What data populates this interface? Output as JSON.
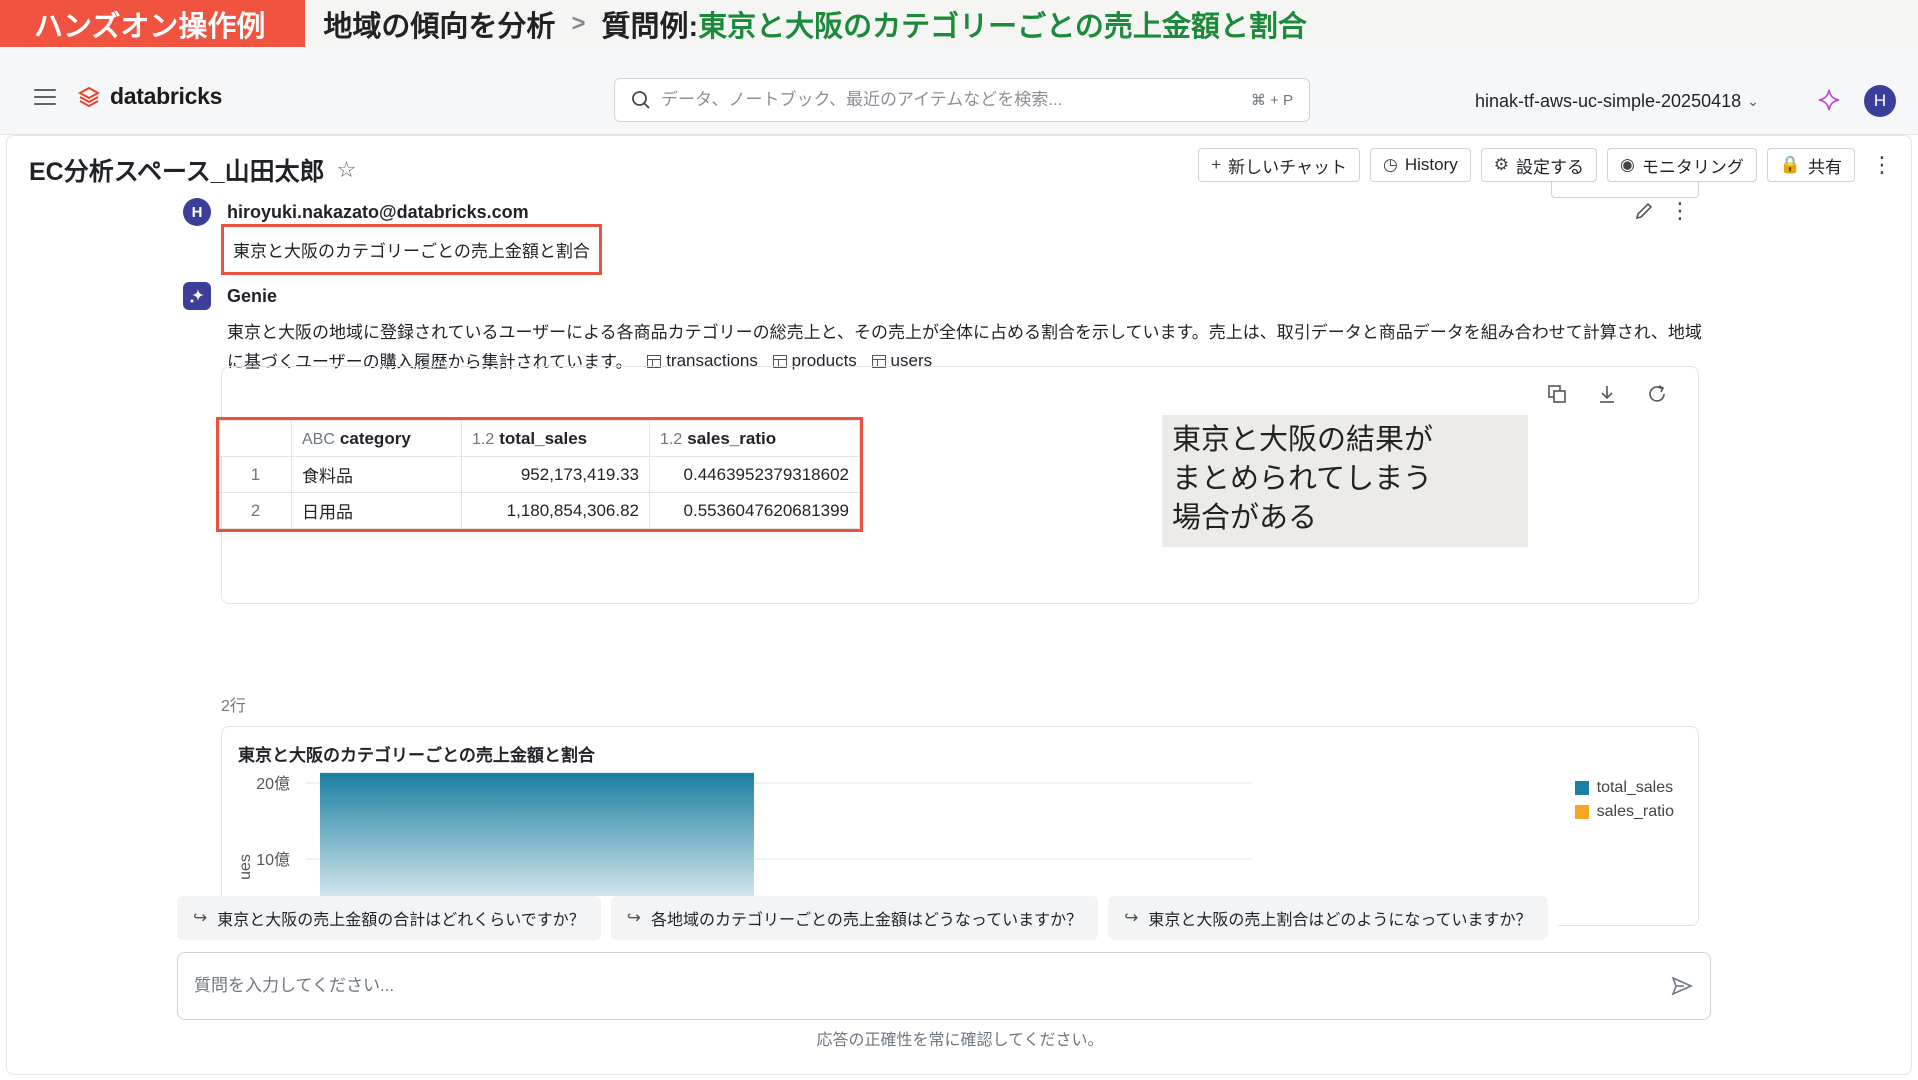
{
  "banner": {
    "tag": "ハンズオン操作例",
    "section": "地域の傾向を分析",
    "separator": ">",
    "question_prefix": "質問例:",
    "question_text": "東京と大阪のカテゴリーごとの売上金額と割合"
  },
  "header": {
    "logo_text": "databricks",
    "search_placeholder": "データ、ノートブック、最近のアイテムなどを検索...",
    "search_shortcut": "⌘ + P",
    "workspace_name": "hinak-tf-aws-uc-simple-20250418",
    "user_initial": "H"
  },
  "space": {
    "title": "EC分析スペース_山田太郎",
    "toolbar": {
      "new_chat": "新しいチャット",
      "history": "History",
      "settings": "設定する",
      "monitoring": "モニタリング",
      "share": "共有"
    }
  },
  "user_message": {
    "initial": "H",
    "email": "hiroyuki.nakazato@databricks.com",
    "question": "東京と大阪のカテゴリーごとの売上金額と割合"
  },
  "genie_message": {
    "name": "Genie",
    "text": "東京と大阪の地域に登録されているユーザーによる各商品カテゴリーの総売上と、その売上が全体に占める割合を示しています。売上は、取引データと商品データを組み合わせて計算され、地域に基づくユーザーの購入履歴から集計されています。",
    "tables": [
      "transactions",
      "products",
      "users"
    ]
  },
  "result_table": {
    "columns": [
      {
        "type": "ABC",
        "name": "category"
      },
      {
        "type": "1.2",
        "name": "total_sales"
      },
      {
        "type": "1.2",
        "name": "sales_ratio"
      }
    ],
    "rows": [
      {
        "index": "1",
        "category": "食料品",
        "total_sales": "952,173,419.33",
        "sales_ratio": "0.4463952379318602"
      },
      {
        "index": "2",
        "category": "日用品",
        "total_sales": "1,180,854,306.82",
        "sales_ratio": "0.5536047620681399"
      }
    ],
    "row_count": "2行"
  },
  "annotation": {
    "line1": "東京と大阪の結果が",
    "line2": "まとめられてしまう",
    "line3": "場合がある"
  },
  "chart_data": {
    "type": "bar",
    "title": "東京と大阪のカテゴリーごとの売上金額と割合",
    "y_tick_labels": [
      "20億",
      "10億"
    ],
    "ylabel": "ues",
    "ylim": [
      0,
      2000000000
    ],
    "series": [
      {
        "name": "total_sales",
        "color": "#1b7fa0",
        "values": [
          2133027726.15
        ]
      },
      {
        "name": "sales_ratio",
        "color": "#f6a623",
        "values": [
          1.0
        ]
      }
    ],
    "legend": "top-right",
    "grid": true
  },
  "suggestions": [
    "東京と大阪の売上金額の合計はどれくらいですか？",
    "各地域のカテゴリーごとの売上金額はどうなっていますか？",
    "東京と大阪の売上割合はどのようになっていますか？"
  ],
  "composer": {
    "placeholder": "質問を入力してください...",
    "disclaimer": "応答の正確性を常に確認してください。"
  }
}
